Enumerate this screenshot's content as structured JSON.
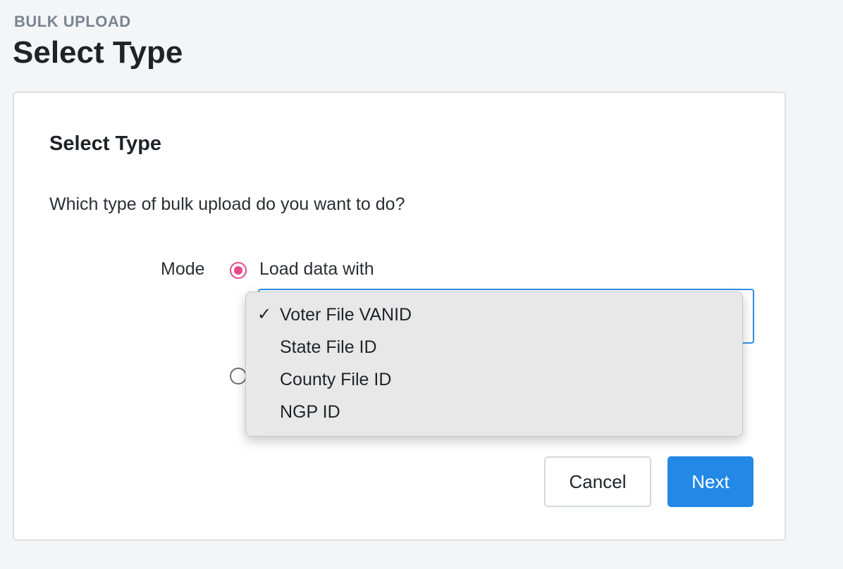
{
  "header": {
    "eyebrow": "BULK UPLOAD",
    "title": "Select Type"
  },
  "card": {
    "title": "Select Type",
    "question": "Which type of bulk upload do you want to do?",
    "mode_label": "Mode",
    "options": [
      {
        "label": "Load data with",
        "selected": true
      },
      {
        "label": "",
        "selected": false
      }
    ],
    "dropdown": {
      "selected": "Voter File VANID",
      "check_glyph": "✓",
      "items": [
        "Voter File VANID",
        "State File ID",
        "County File ID",
        "NGP ID"
      ]
    }
  },
  "actions": {
    "cancel_label": "Cancel",
    "next_label": "Next"
  },
  "colors": {
    "accent": "#2388e6",
    "radio": "#e8478b"
  }
}
